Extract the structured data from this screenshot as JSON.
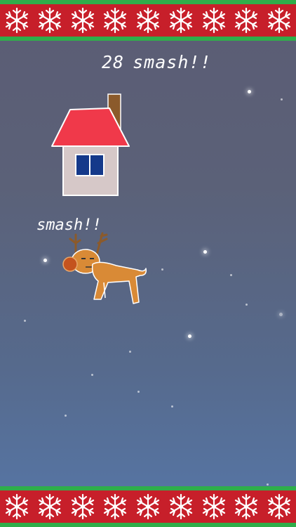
{
  "hud": {
    "smash_count": "28",
    "smash_label": "smash!!"
  },
  "popup_text": "smash!!",
  "colors": {
    "border_red": "#c71f2a",
    "border_green": "#2fae4a",
    "roof": "#f0394a",
    "house_wall": "#d6c8c8",
    "window": "#15398a",
    "chimney": "#8b5a2b",
    "reindeer_body": "#d98a36",
    "reindeer_nose": "#c4531e"
  },
  "icons": {
    "border_pattern": "snowflake-icon"
  }
}
